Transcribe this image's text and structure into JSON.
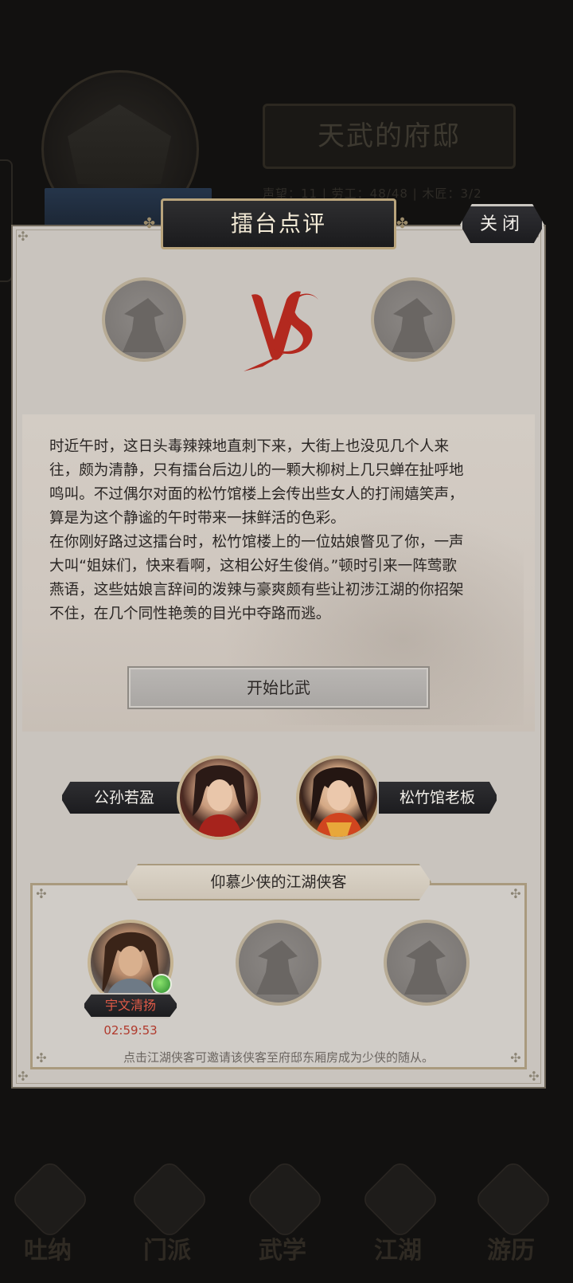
{
  "background": {
    "title": "天武的府邸",
    "stats_text": "声望：11 | 劳工：48/48 | 木匠：3/2",
    "nav": [
      {
        "label": "吐纳",
        "icon": "meditate-icon"
      },
      {
        "label": "门派",
        "icon": "sect-icon"
      },
      {
        "label": "武学",
        "icon": "martial-arts-icon"
      },
      {
        "label": "江湖",
        "icon": "jianghu-icon"
      },
      {
        "label": "游历",
        "icon": "travel-icon"
      }
    ]
  },
  "modal": {
    "title": "擂台点评",
    "close_label": "关闭",
    "vs_label": "VS",
    "story": "时近午时，这日头毒辣辣地直刺下来，大街上也没见几个人来\n往，颇为清静，只有擂台后边儿的一颗大柳树上几只蝉在扯呼地\n鸣叫。不过偶尔对面的松竹馆楼上会传出些女人的打闹嬉笑声，\n算是为这个静谧的午时带来一抹鲜活的色彩。\n在你刚好路过这擂台时，松竹馆楼上的一位姑娘瞥见了你，一声\n大叫“姐妹们，快来看啊，这相公好生俊俏。”顿时引来一阵莺歌\n燕语，这些姑娘言辞间的泼辣与豪爽颇有些让初涉江湖的你招架\n不住，在几个同性艳羡的目光中夺路而逃。",
    "start_button": "开始比武",
    "fighters": {
      "left": {
        "name": "公孙若盈"
      },
      "right": {
        "name": "松竹馆老板"
      }
    },
    "admirers": {
      "title": "仰慕少侠的江湖侠客",
      "heroes": [
        {
          "name": "宇文清扬",
          "timer": "02:59:53"
        }
      ],
      "hint": "点击江湖侠客可邀请该侠客至府邸东厢房成为少侠的随从。"
    }
  },
  "colors": {
    "panel": "#c9c4be",
    "accent_red": "#b0392c",
    "dark_plate": "#1c1c1f",
    "gold_border": "#b9a47c"
  }
}
